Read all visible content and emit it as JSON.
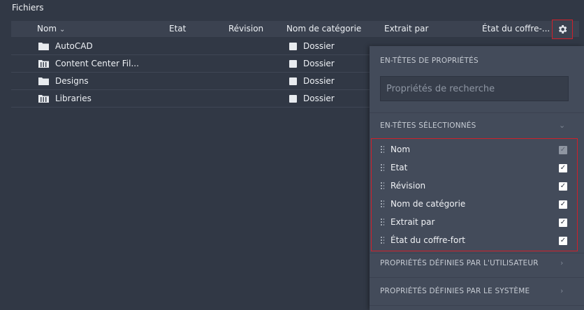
{
  "section_title": "Fichiers",
  "columns": {
    "name": "Nom",
    "state": "Etat",
    "revision": "Révision",
    "category": "Nom de catégorie",
    "checked_out_by": "Extrait par",
    "vault_state": "État du coffre-..."
  },
  "rows": [
    {
      "name": "AutoCAD",
      "icon": "folder-icon",
      "category": "Dossier"
    },
    {
      "name": "Content Center Fil...",
      "icon": "library-folder-icon",
      "category": "Dossier"
    },
    {
      "name": "Designs",
      "icon": "folder-icon",
      "category": "Dossier"
    },
    {
      "name": "Libraries",
      "icon": "library-folder-icon",
      "category": "Dossier"
    }
  ],
  "panel": {
    "properties_heading": "EN-TÊTES DE PROPRIÉTÉS",
    "search_placeholder": "Propriétés de recherche",
    "selected_heading": "EN-TÊTES SÉLECTIONNÉS",
    "selected_items": [
      {
        "label": "Nom",
        "checked": true,
        "disabled": true
      },
      {
        "label": "Etat",
        "checked": true,
        "disabled": false
      },
      {
        "label": "Révision",
        "checked": true,
        "disabled": false
      },
      {
        "label": "Nom de catégorie",
        "checked": true,
        "disabled": false
      },
      {
        "label": "Extrait par",
        "checked": true,
        "disabled": false
      },
      {
        "label": "État du coffre-fort",
        "checked": true,
        "disabled": false
      }
    ],
    "user_defined_heading": "PROPRIÉTÉS DÉFINIES PAR L'UTILISATEUR",
    "system_defined_heading": "PROPRIÉTÉS DÉFINIES PAR LE SYSTÈME"
  },
  "colors": {
    "highlight_border": "#d0202a",
    "panel_bg": "#434b5a",
    "page_bg": "#313845"
  }
}
